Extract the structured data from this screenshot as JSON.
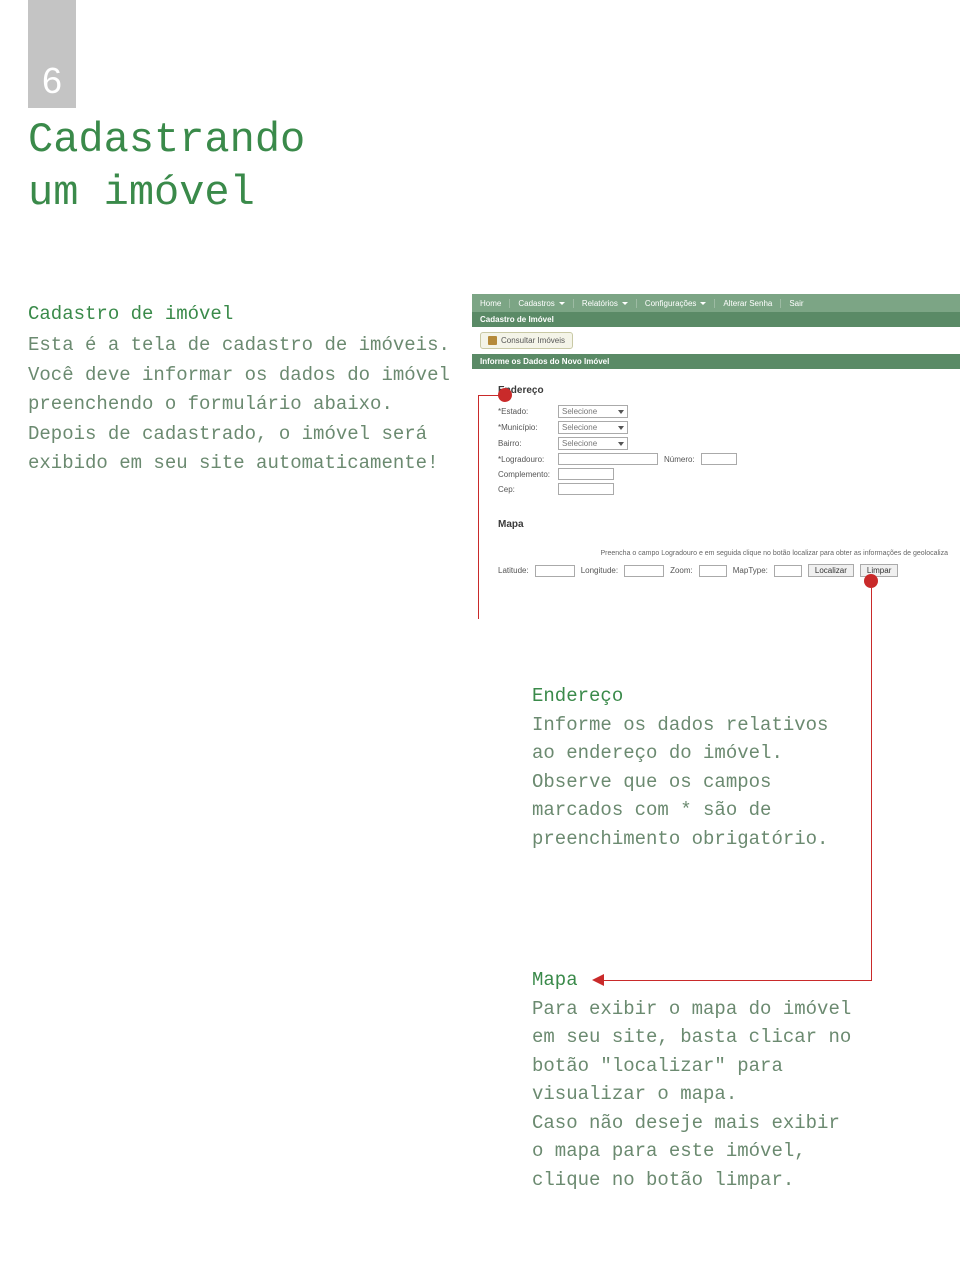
{
  "page_number": "6",
  "title_line1": "Cadastrando",
  "title_line2": "um imóvel",
  "intro": {
    "heading": "Cadastro de imóvel",
    "p1": "Esta é a tela de cadastro de imóveis. Você deve informar os dados do imóvel preenchendo o formulário abaixo.",
    "p2": "Depois de cadastrado, o imóvel será exibido em seu site automaticamente!"
  },
  "callouts": {
    "endereco": {
      "heading": "Endereço",
      "p1": "Informe os dados relativos ao endereço do imóvel.",
      "p2": "Observe que os campos marcados com * são de preenchimento obrigatório."
    },
    "mapa": {
      "heading": "Mapa",
      "p1": "Para exibir o mapa do imóvel em seu site, basta clicar no botão \"localizar\" para visualizar o  mapa.",
      "p2": "Caso não deseje mais exibir o mapa para este imóvel, clique no botão limpar."
    }
  },
  "screenshot": {
    "menu": {
      "home": "Home",
      "cadastros": "Cadastros",
      "relatorios": "Relatórios",
      "config": "Configurações",
      "alterar": "Alterar Senha",
      "sair": "Sair"
    },
    "breadcrumb": "Cadastro de Imóvel",
    "button_consult": "Consultar Imóveis",
    "panel_title": "Informe os Dados do Novo Imóvel",
    "section_endereco": "Endereço",
    "labels": {
      "estado": "*Estado:",
      "municipio": "*Município:",
      "bairro": "Bairro:",
      "logradouro": "*Logradouro:",
      "numero": "Número:",
      "complemento": "Complemento:",
      "cep": "Cep:"
    },
    "select_placeholder": "Selecione",
    "section_mapa": "Mapa",
    "hint": "Preencha o campo Logradouro e em seguida clique no botão localizar para obter as informações de geolocaliza",
    "map_labels": {
      "latitude": "Latitude:",
      "longitude": "Longitude:",
      "zoom": "Zoom:",
      "maptype": "MapType:"
    },
    "btn_localizar": "Localizar",
    "btn_limpar": "Limpar"
  }
}
